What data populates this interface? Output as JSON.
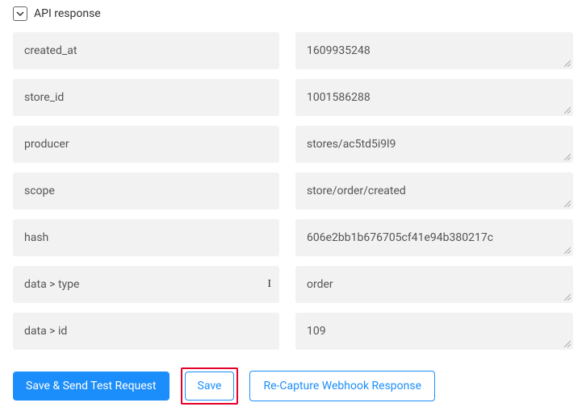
{
  "header": {
    "title": "API response"
  },
  "fields": [
    {
      "key": "created_at",
      "value": "1609935248"
    },
    {
      "key": "store_id",
      "value": "1001586288"
    },
    {
      "key": "producer",
      "value": "stores/ac5td5i9l9"
    },
    {
      "key": "scope",
      "value": "store/order/created"
    },
    {
      "key": "hash",
      "value": "606e2bb1b676705cf41e94b380217c"
    },
    {
      "key": "data > type",
      "value": "order",
      "caret": true
    },
    {
      "key": "data > id",
      "value": "109"
    }
  ],
  "buttons": {
    "save_send": "Save & Send Test Request",
    "save": "Save",
    "recapture": "Re-Capture Webhook Response"
  }
}
